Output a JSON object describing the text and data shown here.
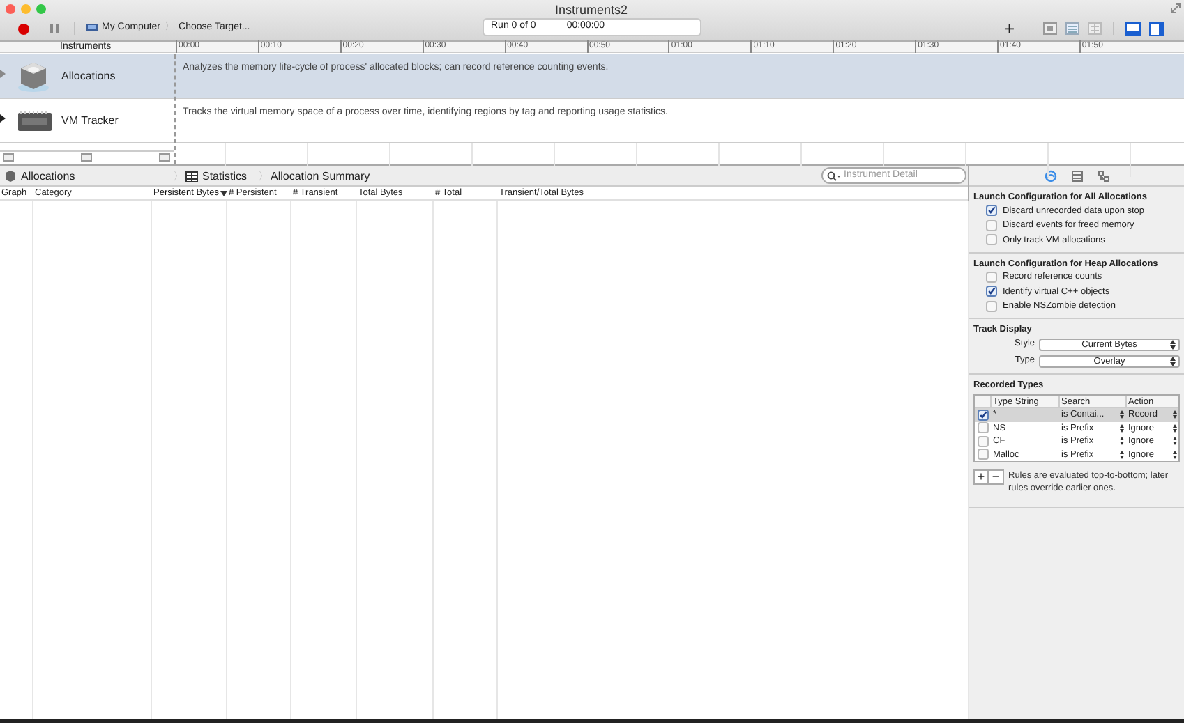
{
  "window": {
    "title": "Instruments2"
  },
  "toolbar": {
    "target": [
      "My Computer",
      "Choose Target..."
    ],
    "separator": "〉",
    "run": "Run 0 of 0",
    "time": "00:00:00",
    "add": "+"
  },
  "timeline": {
    "header": "Instruments",
    "ticks": [
      "00:00",
      "00:10",
      "00:20",
      "00:30",
      "00:40",
      "00:50",
      "01:00",
      "01:10",
      "01:20",
      "01:30",
      "01:40",
      "01:50"
    ]
  },
  "instruments": [
    {
      "kind": "allocations",
      "name": "Allocations",
      "description": "Analyzes the memory life-cycle of process' allocated blocks; can record reference counting events.",
      "selected": true
    },
    {
      "kind": "vm",
      "name": "VM Tracker",
      "description": "Tracks the virtual memory space of a process over time, identifying regions by tag and reporting usage statistics.",
      "selected": false
    }
  ],
  "detail": {
    "breadcrumbs": [
      "Allocations",
      "Statistics",
      "Allocation Summary"
    ],
    "separators": [
      "〉",
      "〉"
    ],
    "search": {
      "placeholder": "Instrument Detail"
    },
    "columns": [
      {
        "label": "Graph",
        "sorted": false
      },
      {
        "label": "Category",
        "sorted": false
      },
      {
        "label": "Persistent Bytes",
        "sorted": true
      },
      {
        "label": "# Persistent",
        "sorted": false
      },
      {
        "label": "# Transient",
        "sorted": false
      },
      {
        "label": "Total Bytes",
        "sorted": false
      },
      {
        "label": "# Total",
        "sorted": false
      },
      {
        "label": "Transient/Total Bytes",
        "sorted": false
      }
    ]
  },
  "inspector": {
    "tabs": [
      {
        "selected": true
      },
      {
        "selected": false
      },
      {
        "selected": false
      }
    ],
    "sections": [
      {
        "kind": "checks",
        "title": "Launch Configuration for All Allocations",
        "items": [
          {
            "label": "Discard unrecorded data upon stop",
            "checked": true
          },
          {
            "label": "Discard events for freed memory",
            "checked": false
          },
          {
            "label": "Only track VM allocations",
            "checked": false
          }
        ]
      },
      {
        "kind": "checks",
        "title": "Launch Configuration for Heap Allocations",
        "items": [
          {
            "label": "Record reference counts",
            "checked": false
          },
          {
            "label": "Identify virtual C++ objects",
            "checked": true
          },
          {
            "label": "Enable NSZombie detection",
            "checked": false
          }
        ]
      },
      {
        "kind": "selects",
        "title": "Track Display",
        "items": [
          {
            "label": "Style",
            "value": "Current Bytes"
          },
          {
            "label": "Type",
            "value": "Overlay"
          }
        ]
      },
      {
        "kind": "types",
        "title": "Recorded Types",
        "columns": [
          "Type String",
          "Search",
          "Action"
        ],
        "rows": [
          {
            "checked": true,
            "selected": true,
            "type_string": "*",
            "search": "is Contai...",
            "action": "Record"
          },
          {
            "checked": false,
            "selected": false,
            "type_string": "NS",
            "search": "is Prefix",
            "action": "Ignore"
          },
          {
            "checked": false,
            "selected": false,
            "type_string": "CF",
            "search": "is Prefix",
            "action": "Ignore"
          },
          {
            "checked": false,
            "selected": false,
            "type_string": "Malloc",
            "search": "is Prefix",
            "action": "Ignore"
          }
        ],
        "add": "+",
        "remove": "−",
        "note": "Rules are evaluated top-to-bottom; later rules override earlier ones."
      }
    ]
  }
}
